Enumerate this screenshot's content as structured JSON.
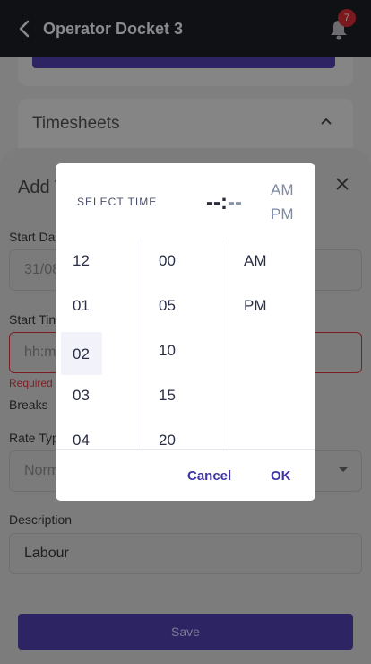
{
  "appbar": {
    "title": "Operator Docket 3",
    "badge_count": "7"
  },
  "background": {
    "timesheets_label": "Timesheets",
    "sheet_title": "Add T",
    "start_date_label": "Start Da",
    "start_date_value": "31/08",
    "start_time_label": "Start Tin",
    "start_time_placeholder": "hh:m",
    "required_text": "Required",
    "breaks_label": "Breaks",
    "rate_type_label": "Rate Typ",
    "rate_type_value": "Norm",
    "description_label": "Description",
    "description_value": "Labour",
    "save_label": "Save"
  },
  "picker": {
    "header_label": "SELECT TIME",
    "hour_display": "--",
    "separator": ":",
    "minute_display": "--",
    "am_label": "AM",
    "pm_label": "PM",
    "hours": [
      "12",
      "01",
      "02",
      "03",
      "04"
    ],
    "minutes": [
      "00",
      "05",
      "10",
      "15",
      "20"
    ],
    "periods": [
      "AM",
      "PM"
    ],
    "selected_hour": "02",
    "cancel_label": "Cancel",
    "ok_label": "OK"
  }
}
